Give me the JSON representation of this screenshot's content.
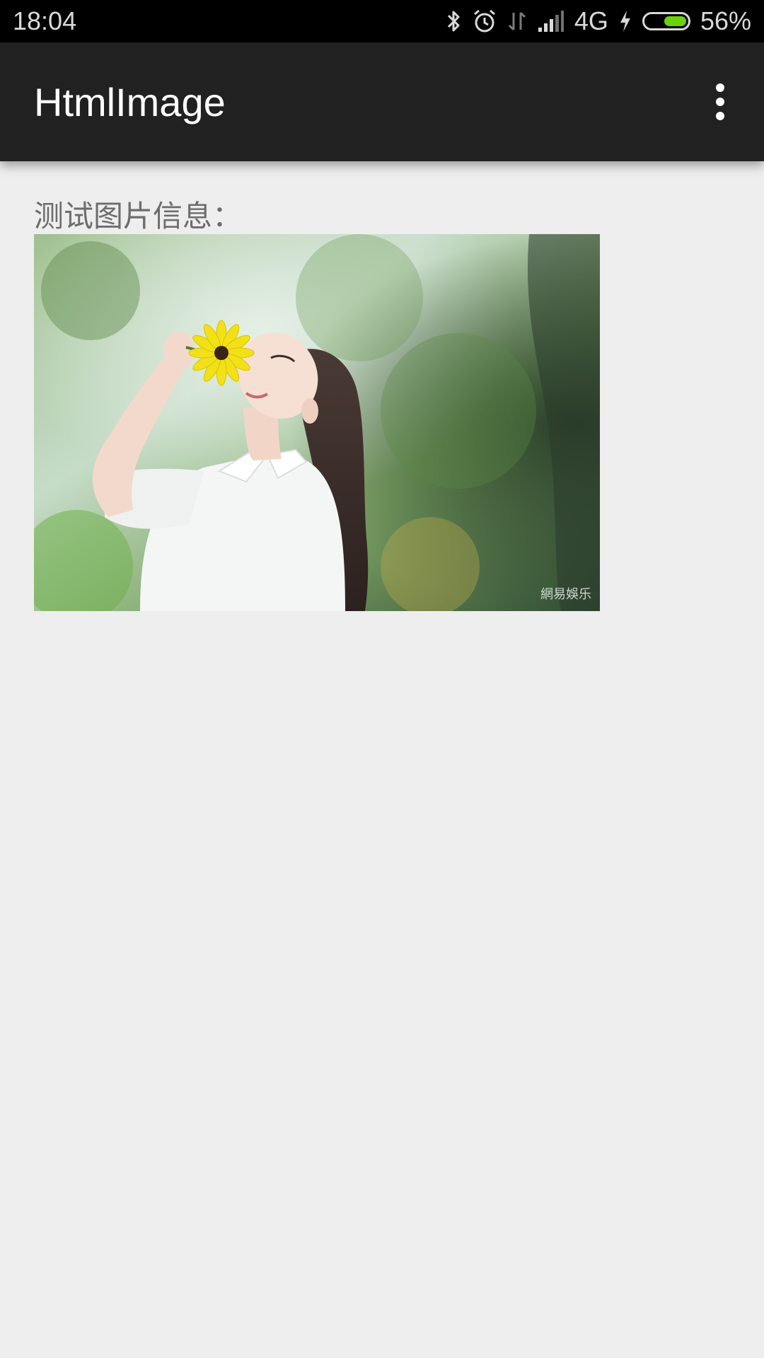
{
  "status_bar": {
    "time": "18:04",
    "network": "4G",
    "battery_percent_text": "56%",
    "battery_level": 0.56,
    "icons": [
      "bluetooth-icon",
      "alarm-icon",
      "data-arrows-icon",
      "signal-icon",
      "charging-icon",
      "battery-icon"
    ]
  },
  "app_bar": {
    "title": "HtmlImage",
    "overflow_icon": "more-vert-icon"
  },
  "content": {
    "label": "测试图片信息：",
    "image_watermark": "網易娛乐"
  },
  "colors": {
    "status_bar_bg": "#000000",
    "app_bar_bg": "#212121",
    "page_bg": "#eeeeee",
    "label_text": "#6d6d6d",
    "battery_fill": "#6ad10a"
  }
}
